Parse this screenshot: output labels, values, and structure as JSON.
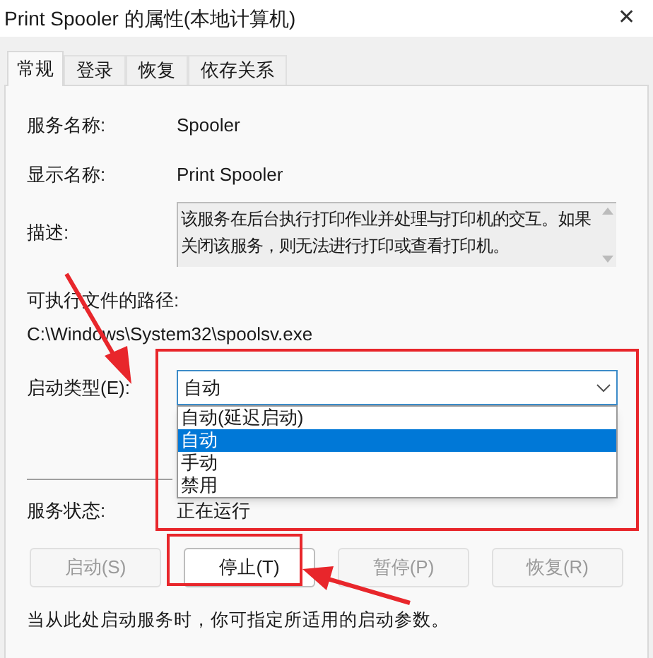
{
  "window": {
    "title": "Print Spooler 的属性(本地计算机)",
    "close": "✕"
  },
  "tabs": [
    {
      "label": "常规",
      "selected": true
    },
    {
      "label": "登录",
      "selected": false
    },
    {
      "label": "恢复",
      "selected": false
    },
    {
      "label": "依存关系",
      "selected": false
    }
  ],
  "service_name": {
    "label": "服务名称:",
    "value": "Spooler"
  },
  "display_name": {
    "label": "显示名称:",
    "value": "Print Spooler"
  },
  "description": {
    "label": "描述:",
    "value": "该服务在后台执行打印作业并处理与打印机的交互。如果关闭该服务，则无法进行打印或查看打印机。"
  },
  "executable_path": {
    "label": "可执行文件的路径:",
    "value": "C:\\Windows\\System32\\spoolsv.exe"
  },
  "startup_type": {
    "label": "启动类型(E):",
    "value": "自动",
    "expanded": true,
    "options": [
      {
        "label": "自动(延迟启动)",
        "selected": false
      },
      {
        "label": "自动",
        "selected": true
      },
      {
        "label": "手动",
        "selected": false
      },
      {
        "label": "禁用",
        "selected": false
      }
    ]
  },
  "service_status": {
    "label": "服务状态:",
    "value": "正在运行"
  },
  "buttons": [
    {
      "label": "启动(S)",
      "disabled": true
    },
    {
      "label": "停止(T)",
      "disabled": false
    },
    {
      "label": "暂停(P)",
      "disabled": true
    },
    {
      "label": "恢复(R)",
      "disabled": true
    }
  ],
  "note": "当从此处启动服务时，你可指定所适用的启动参数。"
}
